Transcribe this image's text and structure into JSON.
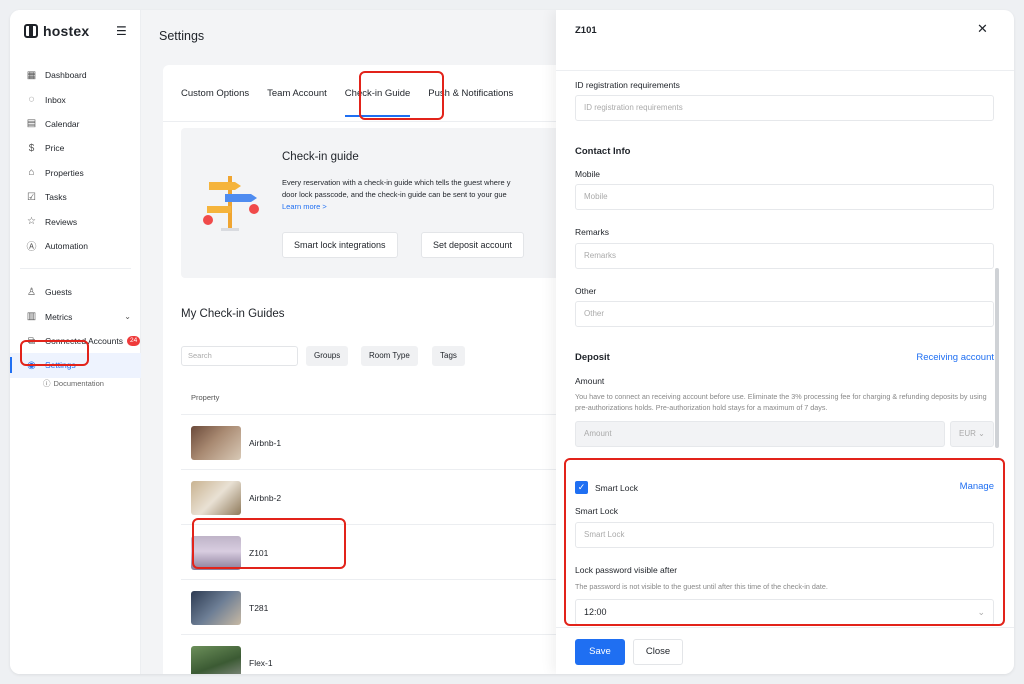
{
  "app": {
    "brand": "hostex",
    "accent": "#1f6ff2"
  },
  "sidebar": {
    "items": [
      {
        "label": "Dashboard",
        "icon": "grid-icon"
      },
      {
        "label": "Inbox",
        "icon": "chat-icon"
      },
      {
        "label": "Calendar",
        "icon": "calendar-icon"
      },
      {
        "label": "Price",
        "icon": "dollar-icon"
      },
      {
        "label": "Properties",
        "icon": "house-icon"
      },
      {
        "label": "Tasks",
        "icon": "checkbox-icon"
      },
      {
        "label": "Reviews",
        "icon": "star-icon"
      },
      {
        "label": "Automation",
        "icon": "automation-icon"
      }
    ],
    "items2": [
      {
        "label": "Guests",
        "icon": "user-icon"
      },
      {
        "label": "Metrics",
        "icon": "chart-icon"
      },
      {
        "label": "Connected Accounts",
        "icon": "network-icon",
        "badge": "24"
      },
      {
        "label": "Settings",
        "icon": "settings-icon"
      }
    ],
    "documentation": "Documentation"
  },
  "main": {
    "title": "Settings",
    "tabs": [
      "Custom Options",
      "Team Account",
      "Check-in Guide",
      "Push & Notifications"
    ],
    "guide": {
      "title": "Check-in guide",
      "desc_line1": "Every reservation with a check-in guide which tells the guest where y",
      "desc_line2": "door lock passcode, and the check-in guide can be sent to your gue",
      "learn_more": "Learn more >",
      "btn_smart_lock": "Smart lock integrations",
      "btn_deposit": "Set deposit account"
    },
    "my_guides_title": "My Check-in Guides",
    "search_placeholder": "Search",
    "filters": [
      "Groups",
      "Room Type",
      "Tags"
    ],
    "column_property": "Property",
    "properties": [
      "Airbnb-1",
      "Airbnb-2",
      "Z101",
      "T281",
      "Flex-1"
    ]
  },
  "drawer": {
    "title": "Z101",
    "id_req_label": "ID registration requirements",
    "id_req_placeholder": "ID registration requirements",
    "contact_info": "Contact Info",
    "mobile_label": "Mobile",
    "mobile_placeholder": "Mobile",
    "remarks_label": "Remarks",
    "remarks_placeholder": "Remarks",
    "other_label": "Other",
    "other_placeholder": "Other",
    "deposit": "Deposit",
    "receiving_account": "Receiving account",
    "amount_label": "Amount",
    "amount_help": "You have to connect an receiving account before use. Eliminate the 3% processing fee for charging & refunding deposits by using pre-authorizations holds. Pre-authorization hold stays for a maximum of 7 days.",
    "amount_placeholder": "Amount",
    "currency": "EUR",
    "smart_lock_check": "Smart Lock",
    "manage": "Manage",
    "smart_lock_label": "Smart Lock",
    "smart_lock_placeholder": "Smart Lock",
    "lock_visible_label": "Lock password visible after",
    "lock_visible_help": "The password is not visible to the guest until after this time of the check-in date.",
    "lock_time": "12:00",
    "save": "Save",
    "close": "Close"
  }
}
